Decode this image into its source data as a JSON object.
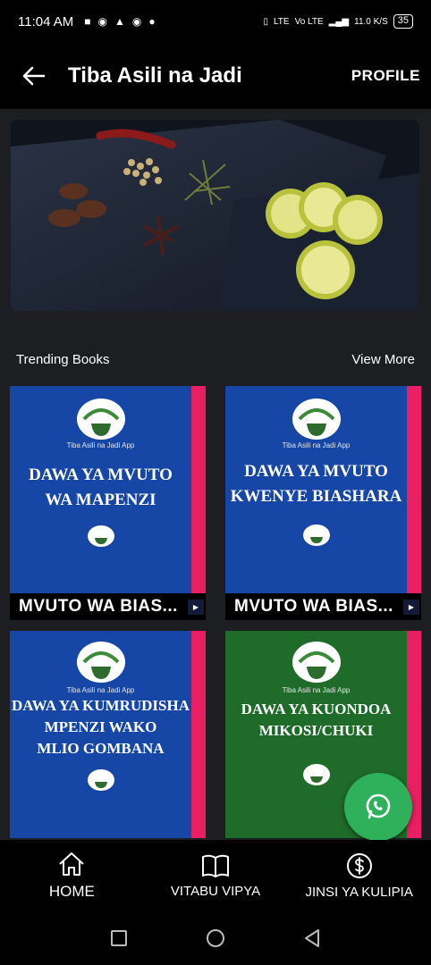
{
  "status_bar": {
    "time": "11:04 AM",
    "network": "LTE",
    "volte": "Vo LTE",
    "speed": "11.0 K/S",
    "battery": "35"
  },
  "app_bar": {
    "title": "Tiba Asili na Jadi",
    "profile_label": "PROFILE"
  },
  "section": {
    "title": "Trending Books",
    "view_more": "View More"
  },
  "books": [
    {
      "cover_title_1": "DAWA YA MVUTO",
      "cover_title_2": "WA MAPENZI",
      "cover_title_3": "",
      "caption": "MVUTO WA BIAS...",
      "app_name": "Tiba Asili na Jadi App",
      "color": "#1646a6"
    },
    {
      "cover_title_1": "DAWA YA MVUTO",
      "cover_title_2": "KWENYE BIASHARA",
      "cover_title_3": "",
      "caption": "MVUTO WA BIAS...",
      "app_name": "Tiba Asili na Jadi App",
      "color": "#1646a6"
    },
    {
      "cover_title_1": "DAWA YA KUMRUDISHA",
      "cover_title_2": "MPENZI WAKO",
      "cover_title_3": "MLIO GOMBANA",
      "caption": "",
      "app_name": "Tiba Asili na Jadi App",
      "color": "#1646a6"
    },
    {
      "cover_title_1": "DAWA YA KUONDOA",
      "cover_title_2": "MIKOSI/CHUKI",
      "cover_title_3": "",
      "caption": "",
      "app_name": "Tiba Asili na Jadi App",
      "color": "#1f6b2a"
    }
  ],
  "bottom_nav": [
    {
      "label": "HOME",
      "icon": "home-icon"
    },
    {
      "label": "VITABU VIPYA",
      "icon": "book-icon"
    },
    {
      "label": "JINSI YA KULIPIA",
      "icon": "dollar-icon"
    }
  ],
  "colors": {
    "accent_strip": "#e91e63",
    "whatsapp": "#2fb05a"
  }
}
